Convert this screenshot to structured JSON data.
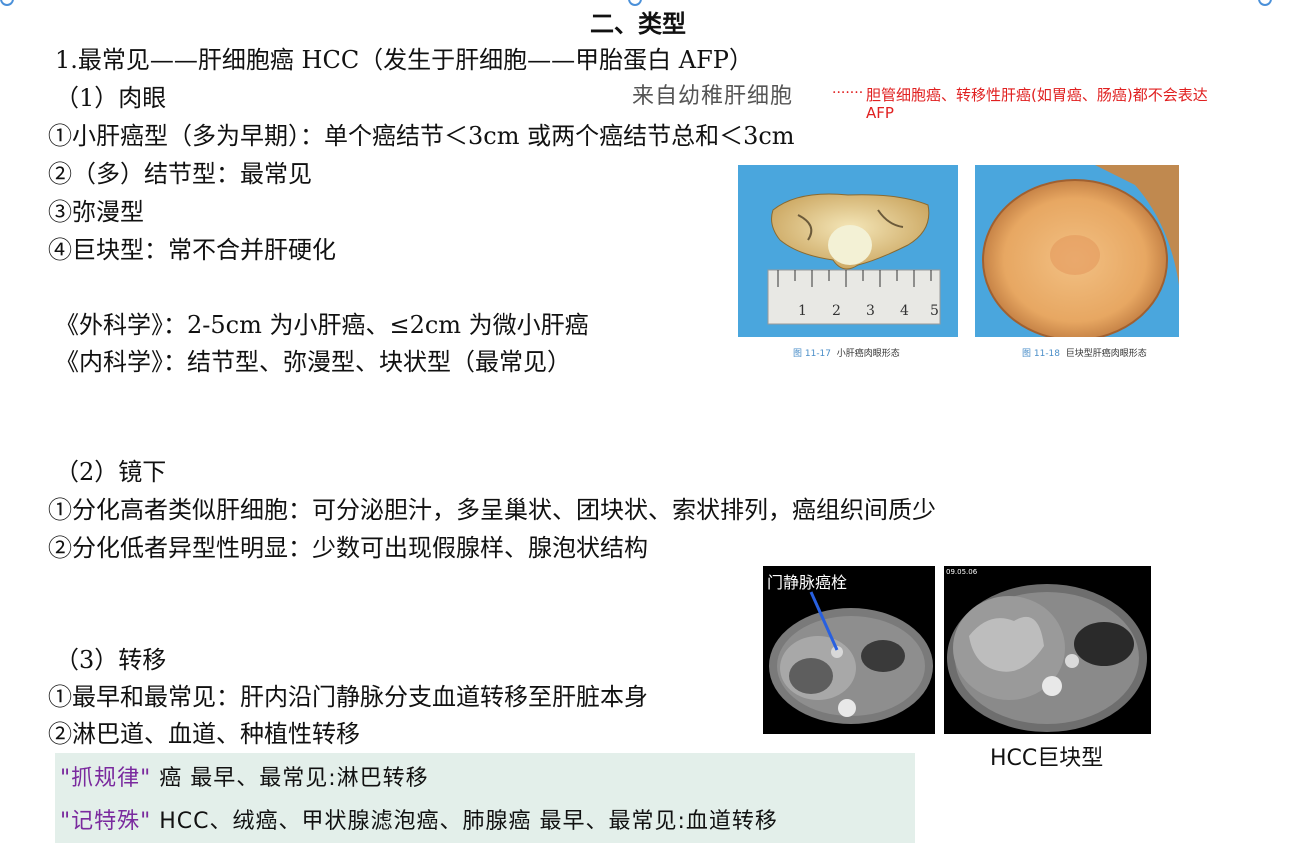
{
  "title": "二、类型",
  "lines": {
    "l1": "1.最常见——肝细胞癌 HCC（发生于肝细胞——甲胎蛋白 AFP）",
    "l2": "（1）肉眼",
    "l3": "①小肝癌型（多为早期）：单个癌结节＜3cm 或两个癌结节总和＜3cm",
    "l4": "②（多）结节型：最常见",
    "l5": "③弥漫型",
    "l6": "④巨块型：常不合并肝硬化",
    "l7": "《外科学》：2-5cm 为小肝癌、≤2cm 为微小肝癌",
    "l8": "《内科学》：结节型、弥漫型、块状型（最常见）",
    "l9": "（2）镜下",
    "l10": "①分化高者类似肝细胞：可分泌胆汁，多呈巢状、团块状、索状排列，癌组织间质少",
    "l11": "②分化低者异型性明显：少数可出现假腺样、腺泡状结构",
    "l12": "（3）转移",
    "l13": "①最早和最常见：肝内沿门静脉分支血道转移至肝脏本身",
    "l14": "②淋巴道、血道、种植性转移"
  },
  "annotations": {
    "gray": "来自幼稚肝细胞",
    "red": "胆管细胞癌、转移性肝癌(如胃癌、肠癌)都不会表达",
    "red2": "AFP"
  },
  "figures": {
    "fig1_num": "图 11-17",
    "fig1_text": "小肝癌肉眼形态",
    "fig2_num": "图 11-18",
    "fig2_text": "巨块型肝癌肉眼形态",
    "ct_label": "门静脉癌栓",
    "ct_date": "09.05.06",
    "hcc_caption": "HCC巨块型",
    "ruler_ticks": [
      "1",
      "2",
      "3",
      "4",
      "5"
    ]
  },
  "highlight": {
    "k1": "\"抓规律\"",
    "r1": "癌  最早、最常见:淋巴转移",
    "k2": "\"记特殊\"",
    "r2": "HCC、绒癌、甲状腺滤泡癌、肺腺癌  最早、最常见:血道转移"
  },
  "colors": {
    "accent_red": "#e02020",
    "purple": "#7a2a9e",
    "highlight_bg": "#e3efea"
  }
}
